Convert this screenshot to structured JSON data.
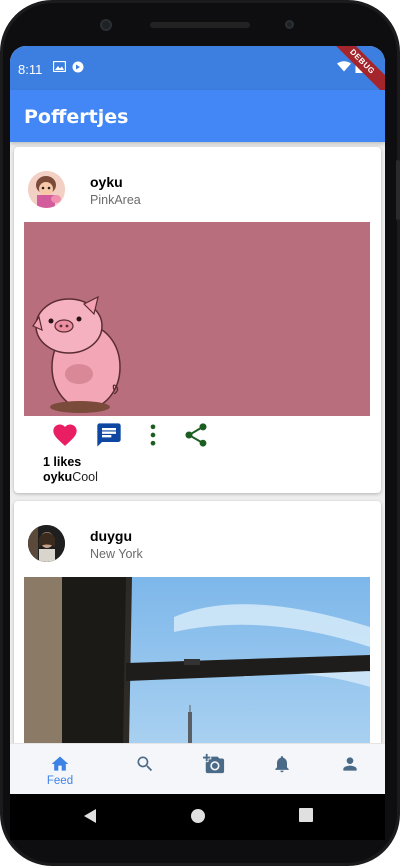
{
  "status_bar": {
    "time": "8:11",
    "debug_label": "DEBUG",
    "debug_color": "#a5252c",
    "icons": [
      "photo-icon",
      "sync-icon",
      "wifi-icon",
      "battery-icon"
    ]
  },
  "app_bar": {
    "title": "Poffertjes",
    "color": "#4287f5"
  },
  "posts": [
    {
      "username": "oyku",
      "location": "PinkArea",
      "image_description_color": "#b86e7d",
      "likes": "1 likes",
      "caption_user": "oyku",
      "caption_text": "Cool",
      "liked": true
    },
    {
      "username": "duygu",
      "location": "New York"
    }
  ],
  "actions": {
    "like_icon": "heart-icon",
    "comment_icon": "comment-icon",
    "more_icon": "more-vert-icon",
    "share_icon": "share-icon",
    "like_color": "#e91e63",
    "comment_color": "#0d47a1",
    "share_color": "#1b5e20"
  },
  "bottom_nav": {
    "items": [
      {
        "label": "Feed",
        "icon": "home-icon",
        "active": true
      },
      {
        "label": "",
        "icon": "search-icon",
        "active": false
      },
      {
        "label": "",
        "icon": "add-photo-icon",
        "active": false
      },
      {
        "label": "",
        "icon": "bell-icon",
        "active": false
      },
      {
        "label": "",
        "icon": "person-icon",
        "active": false
      }
    ],
    "active_color": "#3d83e6",
    "inactive_color": "#4a6a87"
  },
  "system_nav": {
    "buttons": [
      "back-icon",
      "home-circle-icon",
      "recents-icon"
    ]
  }
}
